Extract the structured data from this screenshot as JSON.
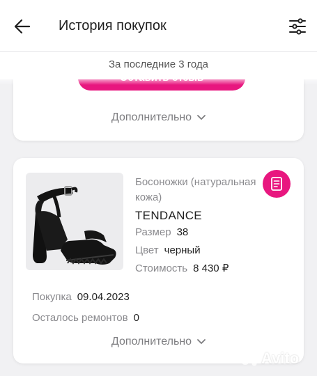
{
  "header": {
    "title": "История покупок",
    "back_icon": "arrow-left-icon",
    "filter_icon": "sliders-icon"
  },
  "period": "За последние 3 года",
  "card1": {
    "review_button": "Оставить отзыв",
    "more_label": "Дополнительно"
  },
  "card2": {
    "product_type": "Босоножки (натуральная кожа)",
    "brand": "TENDANCE",
    "size_label": "Размер",
    "size_value": "38",
    "color_label": "Цвет",
    "color_value": "черный",
    "price_label": "Стоимость",
    "price_value": "8 430 ₽",
    "purchase_label": "Покупка",
    "purchase_date": "09.04.2023",
    "repairs_label": "Осталось ремонтов",
    "repairs_value": "0",
    "more_label": "Дополнительно",
    "receipt_icon": "receipt-icon"
  },
  "colors": {
    "accent": "#e8177f",
    "background": "#f1f1f3",
    "muted_text": "#8a8a8e"
  },
  "watermark": "Avito"
}
